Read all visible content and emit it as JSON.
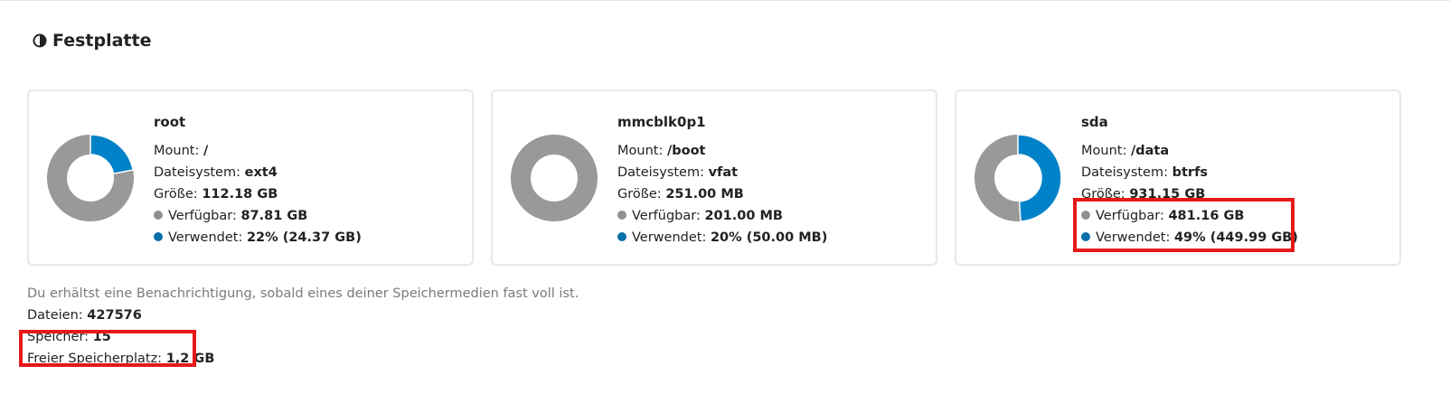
{
  "section": {
    "title": "Festplatte",
    "icon": "pie-chart-icon"
  },
  "labels": {
    "mount": "Mount:",
    "filesystem": "Dateisystem:",
    "size": "Größe:",
    "available": "Verfügbar:",
    "used": "Verwendet:"
  },
  "colors": {
    "available": "#999999",
    "used": "#0082c9",
    "highlight": "#e81818"
  },
  "disks": [
    {
      "name": "root",
      "mount": "/",
      "filesystem": "ext4",
      "size": "112.18 GB",
      "available": "87.81 GB",
      "used": "22% (24.37 GB)",
      "used_fraction": 0.22
    },
    {
      "name": "mmcblk0p1",
      "mount": "/boot",
      "filesystem": "vfat",
      "size": "251.00 MB",
      "available": "201.00 MB",
      "used": "20% (50.00 MB)",
      "used_fraction": 0.0
    },
    {
      "name": "sda",
      "mount": "/data",
      "filesystem": "btrfs",
      "size": "931.15 GB",
      "available": "481.16 GB",
      "used": "49% (449.99 GB)",
      "used_fraction": 0.49
    }
  ],
  "footer": {
    "hint": "Du erhältst eine Benachrichtigung, sobald eines deiner Speichermedien fast voll ist.",
    "files_label": "Dateien:",
    "files_value": "427576",
    "storages_label": "Speicher:",
    "storages_value": "15",
    "free_space_label": "Freier Speicherplatz:",
    "free_space_value": "1,2 GB"
  }
}
